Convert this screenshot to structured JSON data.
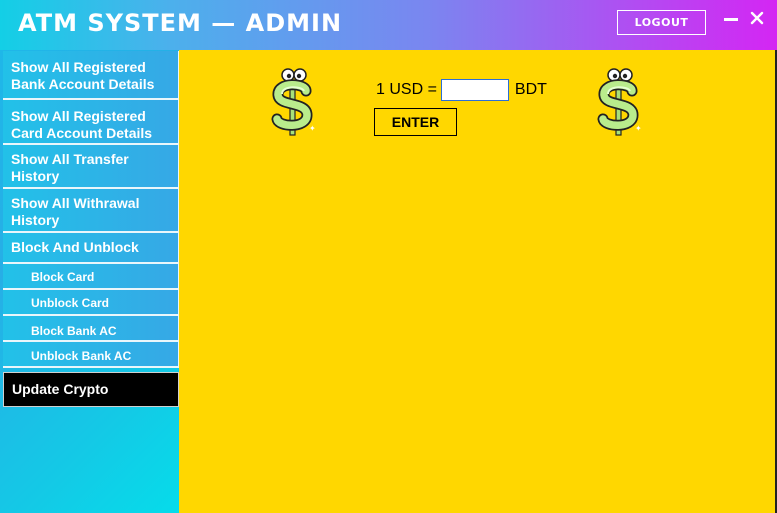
{
  "window": {
    "title": "ATM SYSTEM — ADMIN",
    "logout_label": "LOGOUT",
    "minimize_icon": "minimize-icon",
    "close_icon": "close-icon"
  },
  "sidebar": {
    "items": [
      {
        "label": "Show All Registered Bank Account Details",
        "sub": false,
        "active": false
      },
      {
        "label": "Show All Registered Card Account Details",
        "sub": false,
        "active": false
      },
      {
        "label": "Show All Transfer History",
        "sub": false,
        "active": false
      },
      {
        "label": "Show All Withrawal History",
        "sub": false,
        "active": false
      },
      {
        "label": "Block And Unblock",
        "sub": false,
        "active": false
      },
      {
        "label": "Block Card",
        "sub": true,
        "active": false
      },
      {
        "label": "Unblock Card",
        "sub": true,
        "active": false
      },
      {
        "label": "Block Bank AC",
        "sub": true,
        "active": false
      },
      {
        "label": "Unblock Bank AC",
        "sub": true,
        "active": false
      },
      {
        "label": "Update Crypto",
        "sub": false,
        "active": true
      }
    ]
  },
  "main": {
    "rate_prefix": "1 USD =",
    "rate_value": "",
    "rate_suffix": "BDT",
    "enter_label": "ENTER",
    "decoration_icon": "dollar-sign-character-icon"
  },
  "colors": {
    "header_gradient_start": "#13cfe6",
    "header_gradient_end": "#d426f3",
    "sidebar": "#27aee6",
    "main_background": "#ffd700",
    "active_item": "#000000"
  }
}
